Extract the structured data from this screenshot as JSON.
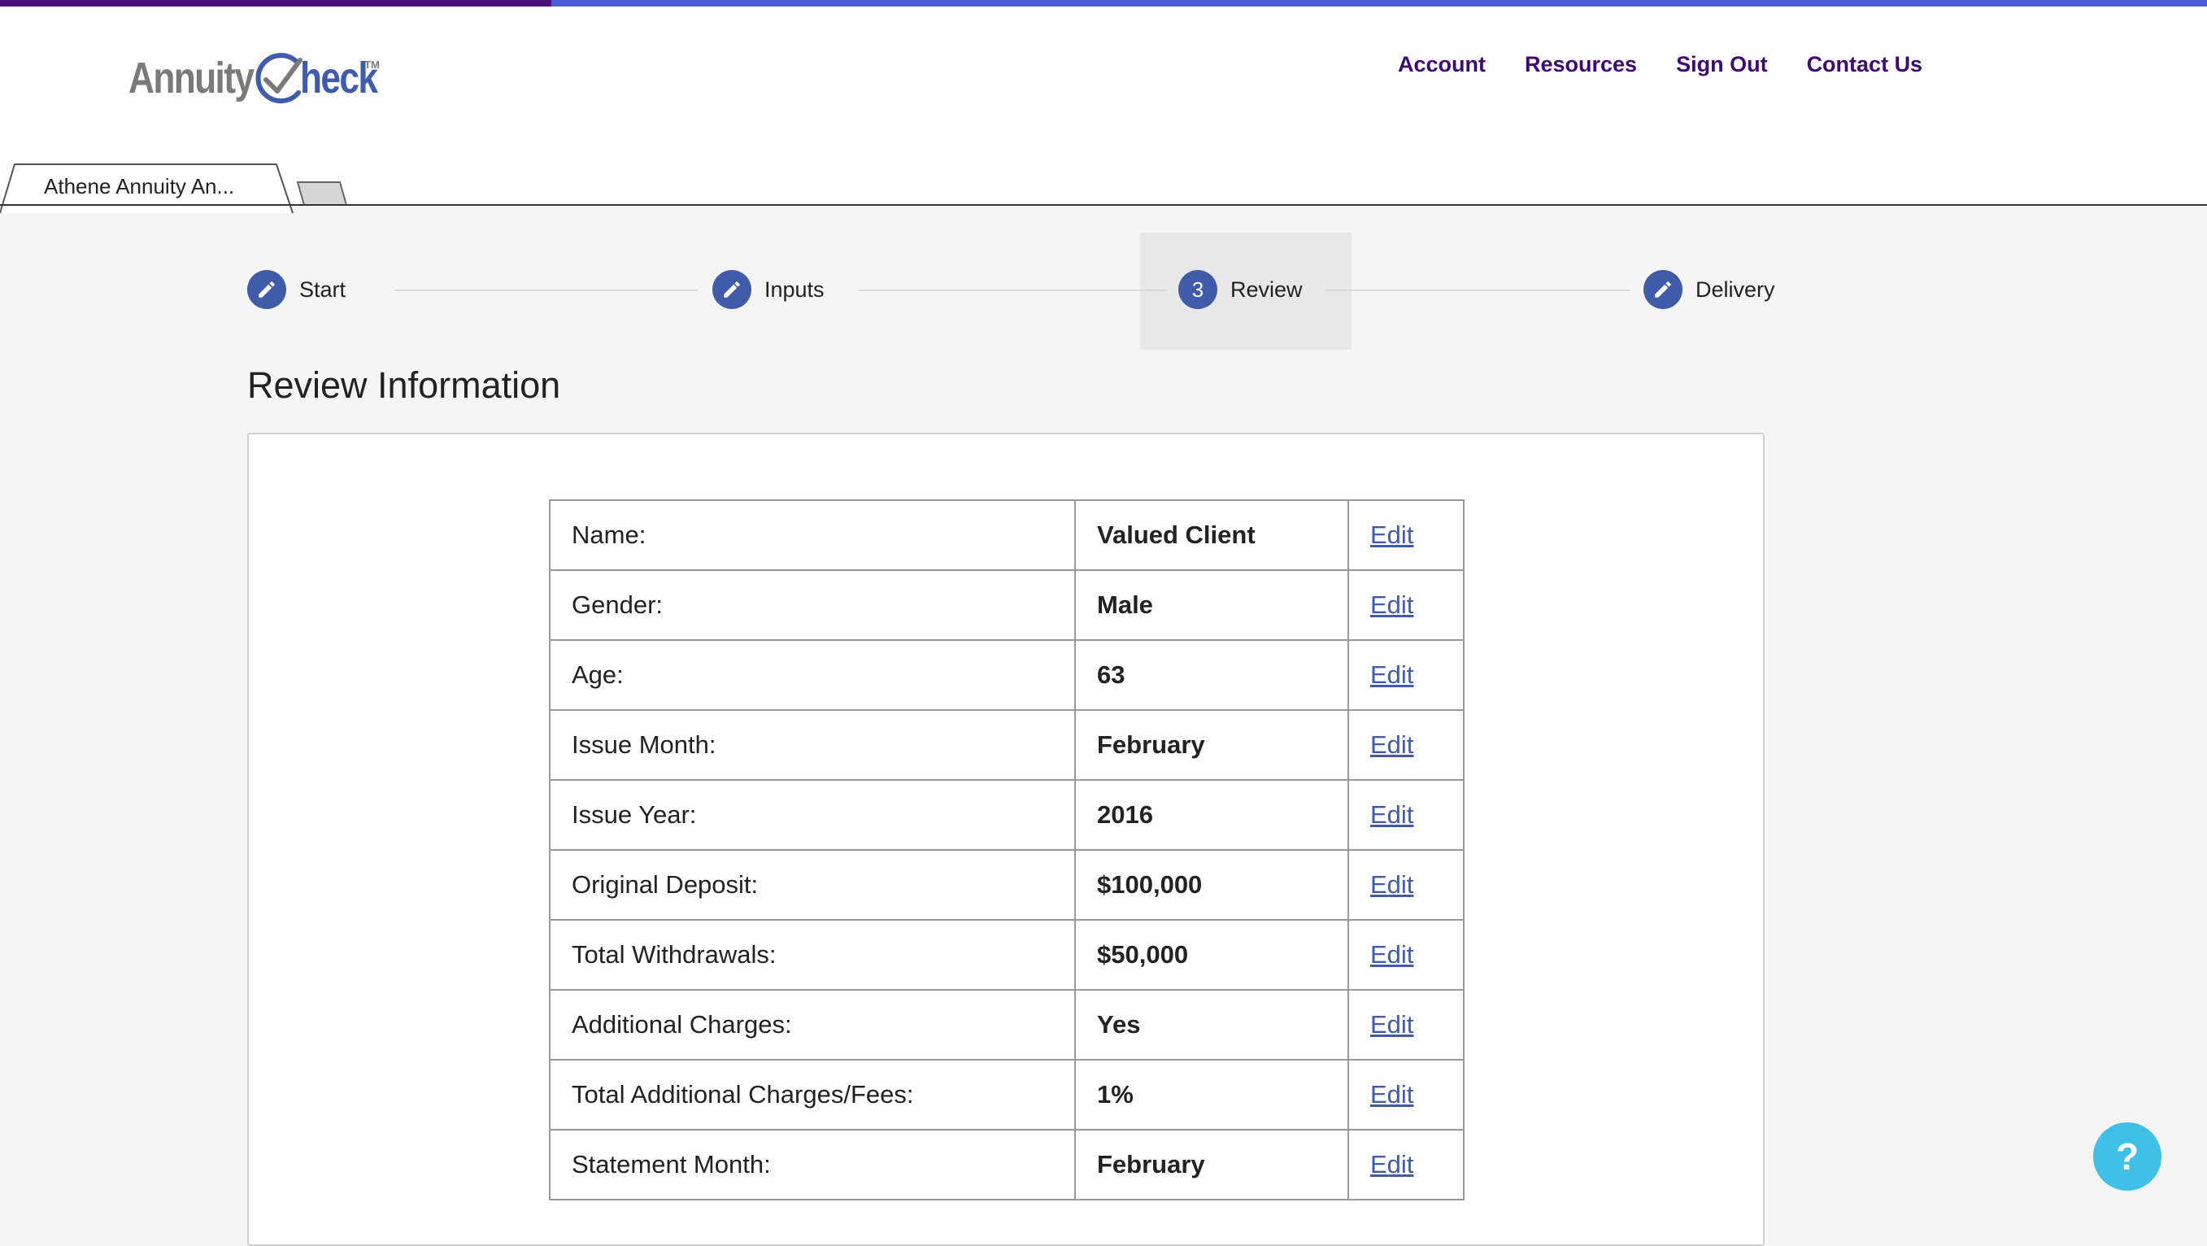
{
  "colors": {
    "top_bar_left": "#4a0f7a",
    "top_bar_right": "#4d59d6",
    "nav_link": "#3d0a70",
    "logo_gray": "#7a7a7a",
    "logo_blue": "#3f5ba9",
    "step_blue": "#3f5ba9",
    "link_blue": "#3f5ba9",
    "help_button": "#3fc0e8"
  },
  "header": {
    "logo": {
      "part1": "Annuity",
      "part2": "heck",
      "tm": "TM"
    },
    "nav": [
      {
        "label": "Account"
      },
      {
        "label": "Resources"
      },
      {
        "label": "Sign Out"
      },
      {
        "label": "Contact Us"
      }
    ]
  },
  "tabs": {
    "active_label": "Athene Annuity An...",
    "new_tab_icon": "new-tab-icon"
  },
  "stepper": {
    "steps": [
      {
        "label": "Start",
        "icon": "pencil-icon",
        "number": ""
      },
      {
        "label": "Inputs",
        "icon": "pencil-icon",
        "number": ""
      },
      {
        "label": "Review",
        "icon": "",
        "number": "3"
      },
      {
        "label": "Delivery",
        "icon": "pencil-icon",
        "number": ""
      }
    ],
    "active": "Review"
  },
  "main": {
    "title": "Review Information",
    "rows": [
      {
        "label": "Name:",
        "value": "Valued Client",
        "action": "Edit"
      },
      {
        "label": "Gender:",
        "value": "Male",
        "action": "Edit"
      },
      {
        "label": "Age:",
        "value": "63",
        "action": "Edit"
      },
      {
        "label": "Issue Month:",
        "value": "February",
        "action": "Edit"
      },
      {
        "label": "Issue Year:",
        "value": "2016",
        "action": "Edit"
      },
      {
        "label": "Original Deposit:",
        "value": "$100,000",
        "action": "Edit"
      },
      {
        "label": "Total Withdrawals:",
        "value": "$50,000",
        "action": "Edit"
      },
      {
        "label": "Additional Charges:",
        "value": "Yes",
        "action": "Edit"
      },
      {
        "label": "Total Additional Charges/Fees:",
        "value": "1%",
        "action": "Edit"
      },
      {
        "label": "Statement Month:",
        "value": "February",
        "action": "Edit"
      }
    ]
  },
  "help": {
    "label": "?"
  }
}
